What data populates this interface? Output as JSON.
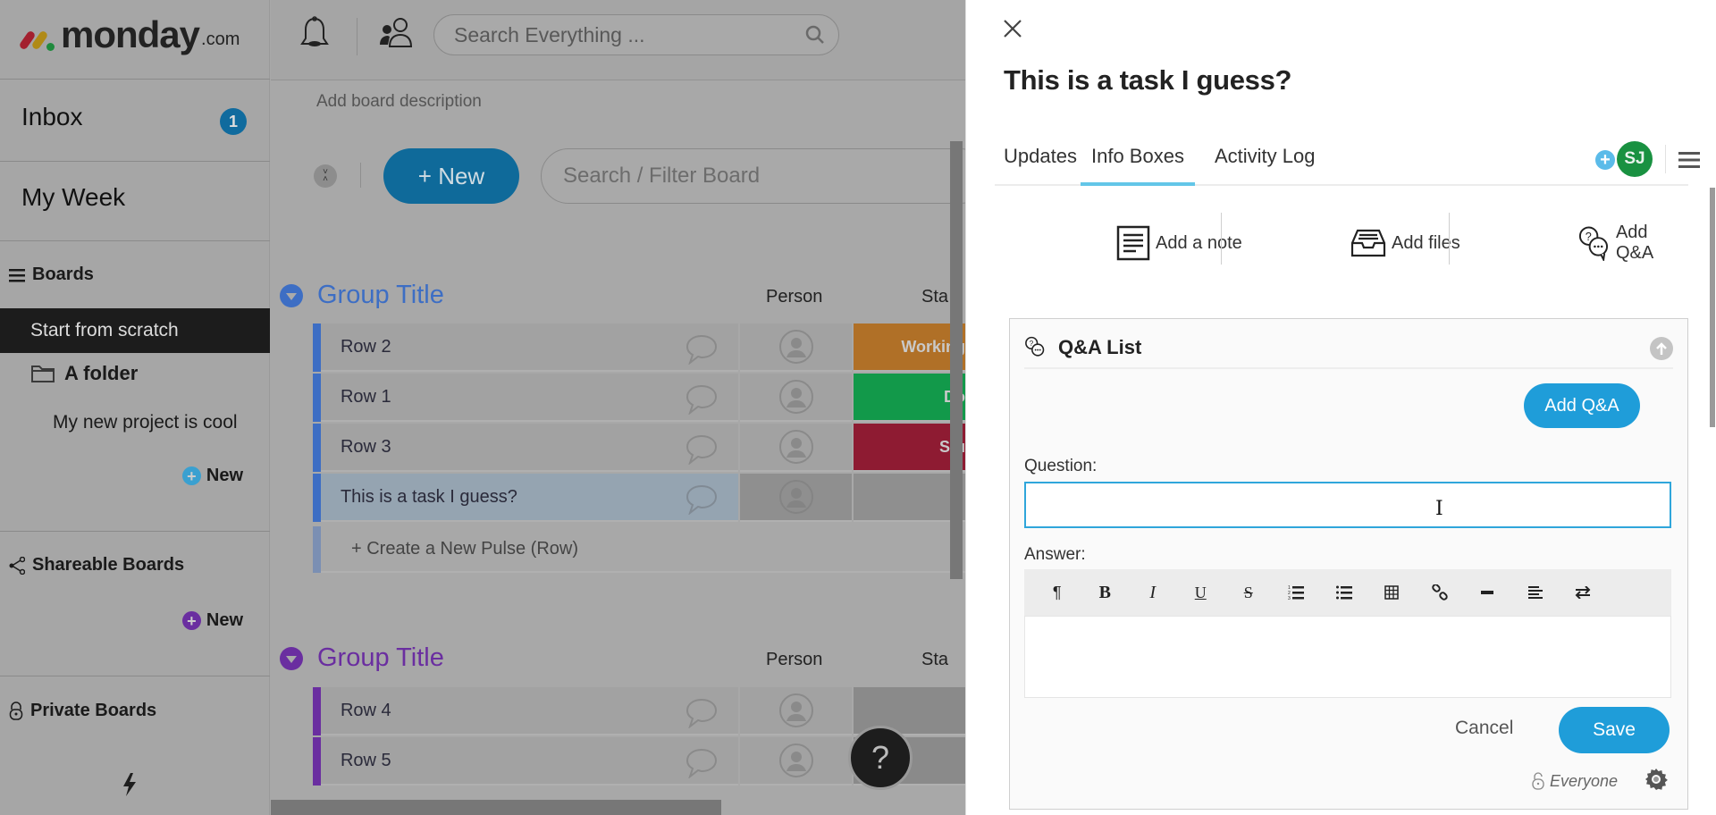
{
  "app": {
    "logo_text": "monday",
    "logo_suffix": ".com"
  },
  "sidebar": {
    "inbox_label": "Inbox",
    "inbox_count": "1",
    "my_week_label": "My Week",
    "boards_label": "Boards",
    "start_from_scratch": "Start from scratch",
    "folder_label": "A folder",
    "project_label": "My new project is cool",
    "new_label_1": "New",
    "shareable_label": "Shareable Boards",
    "new_label_2": "New",
    "private_label": "Private Boards",
    "colors": {
      "badge": "#106b9e",
      "new_main": "#3aa0d0",
      "new_shareable": "#6a2ea0"
    }
  },
  "topbar": {
    "search_placeholder": "Search Everything ..."
  },
  "board": {
    "description_placeholder": "Add board description",
    "new_button": "+ New",
    "filter_placeholder": "Search / Filter Board",
    "groups": [
      {
        "title": "Group Title",
        "color": "#3d6ec4",
        "columns": {
          "person": "Person",
          "status": "Sta"
        },
        "rows": [
          {
            "name": "Row 2",
            "status": "Working",
            "status_color": "#b07027"
          },
          {
            "name": "Row 1",
            "status": "Do",
            "status_color": "#12994a"
          },
          {
            "name": "Row 3",
            "status": "Stu",
            "status_color": "#8e1b32"
          },
          {
            "name": "This is a task I guess?",
            "status": "",
            "status_color": "#8f8f8f",
            "selected": true
          }
        ],
        "create_row_label": "+ Create a New Pulse (Row)"
      },
      {
        "title": "Group Title",
        "color": "#6a2ea0",
        "columns": {
          "person": "Person",
          "status": "Sta"
        },
        "rows": [
          {
            "name": "Row 4",
            "status": "",
            "status_color": "#8a8a8a"
          },
          {
            "name": "Row 5",
            "status": "",
            "status_color": "#8a8a8a"
          }
        ]
      }
    ],
    "help_label": "?"
  },
  "panel": {
    "title": "This is a task I guess?",
    "tabs": [
      {
        "label": "Updates",
        "active": false
      },
      {
        "label": "Info Boxes",
        "active": true
      },
      {
        "label": "Activity Log",
        "active": false
      }
    ],
    "avatar_initials": "SJ",
    "actions": {
      "add_note": "Add a note",
      "add_files": "Add files",
      "add_qa": "Add Q&A"
    },
    "qa": {
      "header": "Q&A List",
      "add_button": "Add Q&A",
      "question_label": "Question:",
      "question_value": "",
      "answer_label": "Answer:",
      "toolbar": [
        "paragraph-icon",
        "bold-icon",
        "italic-icon",
        "underline-icon",
        "strikethrough-icon",
        "ordered-list-icon",
        "unordered-list-icon",
        "table-icon",
        "link-icon",
        "horizontal-rule-icon",
        "align-icon",
        "text-direction-icon"
      ],
      "cancel_label": "Cancel",
      "save_label": "Save",
      "visibility_label": "Everyone"
    },
    "colors": {
      "accent": "#1f9dd9",
      "tab_underline": "#63c6e8",
      "avatar": "#199141"
    }
  }
}
